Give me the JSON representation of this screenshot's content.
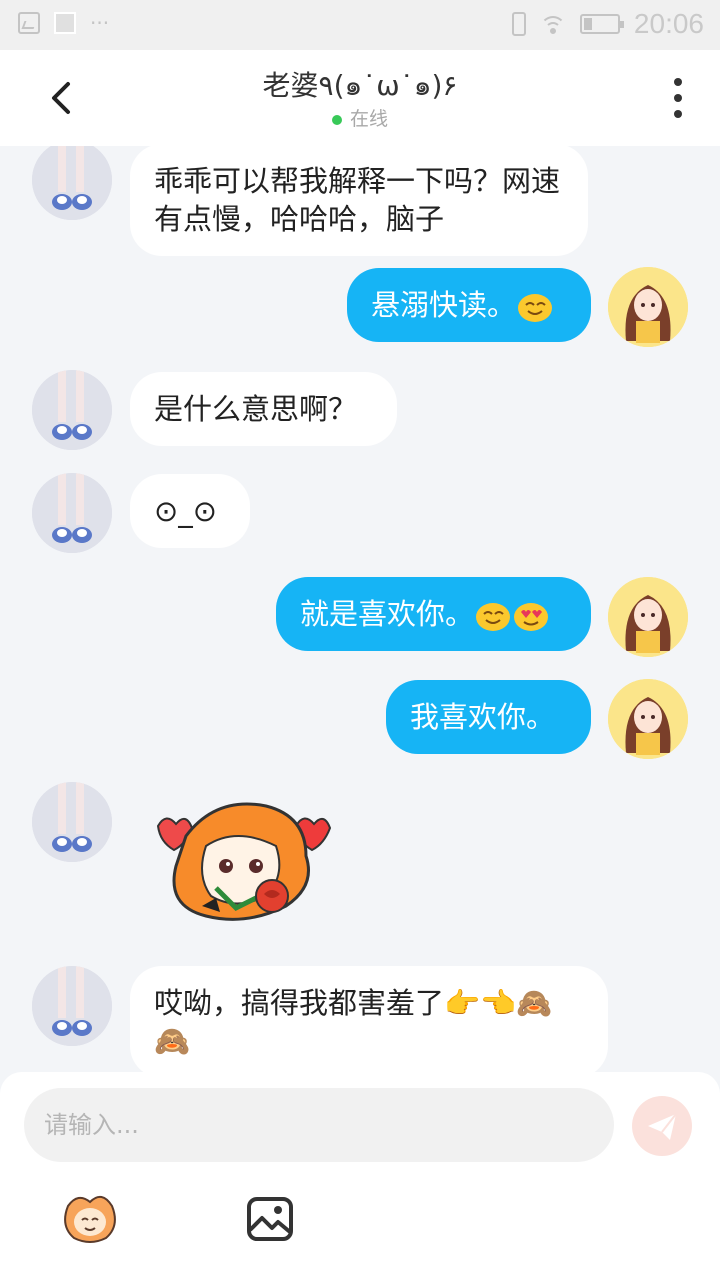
{
  "status_bar": {
    "time": "20:06"
  },
  "header": {
    "title": "老婆٩(๑˙ω˙๑)۶",
    "status": "在线"
  },
  "messages": [
    {
      "from": "other",
      "text": "乖乖可以帮我解释一下吗？网速有点慢，哈哈哈，脑子"
    },
    {
      "from": "me",
      "text": "悬溺快读。",
      "emoji": [
        "smile-emoji"
      ]
    },
    {
      "from": "other",
      "text": "是什么意思啊？"
    },
    {
      "from": "other",
      "text": "⊙_⊙"
    },
    {
      "from": "me",
      "text": "就是喜欢你。",
      "emoji": [
        "smile-emoji",
        "heart-eyes-emoji"
      ]
    },
    {
      "from": "me",
      "text": "我喜欢你。"
    },
    {
      "from": "other",
      "sticker": "rose-mascot-sticker"
    },
    {
      "from": "other",
      "text": "哎呦，搞得我都害羞了👉👈🙈🙈"
    }
  ],
  "composer": {
    "placeholder": "请输入...",
    "value": ""
  },
  "toolbar": {
    "icons": [
      "mascot-emoji-icon",
      "image-icon",
      "send-icon"
    ]
  },
  "colors": {
    "my_bubble": "#16b4f5",
    "other_bubble": "#ffffff",
    "background": "#f3f5f8",
    "online": "#38c958",
    "send_button": "#fbe1dc"
  }
}
